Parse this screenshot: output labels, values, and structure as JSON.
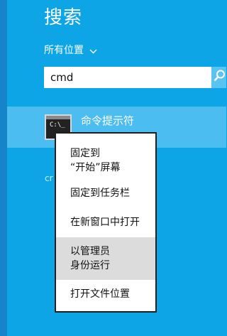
{
  "header": {
    "title": "搜索"
  },
  "scope": {
    "label": "所有位置",
    "chevron_icon": "chevron-down-icon"
  },
  "search": {
    "value": "cmd",
    "button_icon": "search-icon"
  },
  "results": [
    {
      "label": "命令提示符",
      "icon": "command-prompt-icon",
      "icon_text": "C:\\_"
    }
  ],
  "hidden_text": "cr",
  "context_menu": {
    "items": [
      {
        "lines": [
          "固定到",
          "“开始”屏幕"
        ],
        "highlighted": false
      },
      {
        "lines": [
          "固定到任务栏"
        ],
        "highlighted": false
      },
      {
        "lines": [
          "在新窗口中打开"
        ],
        "highlighted": false
      },
      {
        "lines": [
          "以管理员",
          "身份运行"
        ],
        "highlighted": true
      },
      {
        "lines": [
          "打开文件位置"
        ],
        "highlighted": false
      }
    ]
  },
  "colors": {
    "panel_background": "#0ea5e6",
    "left_strip": "#1584c9",
    "selected_result": "#4bbdf0",
    "search_button": "#5ac4f0",
    "menu_highlight": "#dcdcdc"
  }
}
